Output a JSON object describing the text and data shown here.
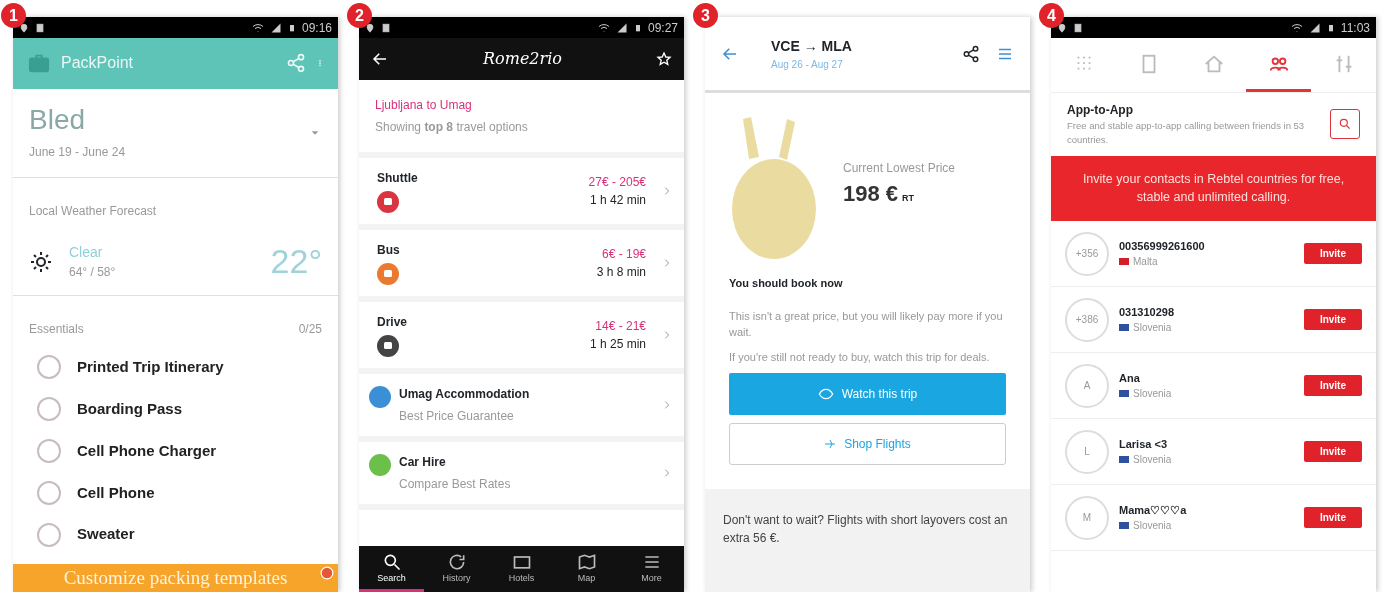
{
  "screens": [
    {
      "kind": "packing",
      "badge": "1",
      "status_time": "09:16",
      "app_title": "PackPoint",
      "trip": {
        "name": "Bled",
        "dates": "June 19 - June 24"
      },
      "weather": {
        "heading": "Local Weather Forecast",
        "condition": "Clear",
        "range": "64° / 58°",
        "temperature": "22°"
      },
      "list": {
        "heading": "Essentials",
        "count": "0/25",
        "items": [
          {
            "label": "Printed Trip Itinerary",
            "checked": false
          },
          {
            "label": "Boarding Pass",
            "checked": false
          },
          {
            "label": "Cell Phone Charger",
            "checked": false
          },
          {
            "label": "Cell Phone",
            "checked": false
          },
          {
            "label": "Sweater",
            "checked": false
          }
        ]
      },
      "footer": "Customize packing templates"
    },
    {
      "kind": "routes",
      "badge": "2",
      "status_time": "09:27",
      "logo": "Rome2rio",
      "route": "Ljubljana to Umag",
      "summary": "Showing **top 8** travel options",
      "options": [
        {
          "mode": "Shuttle",
          "price": "27€ - 205€",
          "duration": "1 h 42 min",
          "color": "#d9343f"
        },
        {
          "mode": "Bus",
          "price": "6€ - 19€",
          "duration": "3 h 8 min",
          "color": "#ec7a2e"
        },
        {
          "mode": "Drive",
          "price": "14€ - 21€",
          "duration": "1 h 25 min",
          "color": "#444444"
        }
      ],
      "links": [
        {
          "title": "Umag Accommodation",
          "subtitle": "Best Price Guarantee",
          "color": "#3a8fd6"
        },
        {
          "title": "Car Hire",
          "subtitle": "Compare Best Rates",
          "color": "#6cc04a"
        }
      ],
      "nav": [
        {
          "label": "Search",
          "selected": true
        },
        {
          "label": "History",
          "selected": false
        },
        {
          "label": "Hotels",
          "selected": false
        },
        {
          "label": "Map",
          "selected": false
        },
        {
          "label": "More",
          "selected": false
        }
      ]
    },
    {
      "kind": "price",
      "badge": "3",
      "route": "VCE → MLA",
      "dates": "Aug 26 - Aug 27",
      "price_label": "Current Lowest Price",
      "price": "198 €",
      "price_note": "RT",
      "advice": "You should book now",
      "paragraphs": [
        "This isn't a great price, but you will likely pay more if you wait.",
        "If you're still not ready to buy, watch this trip for deals."
      ],
      "buttons": [
        {
          "label": "Watch this trip",
          "kind": "primary"
        },
        {
          "label": "Shop Flights",
          "kind": "outline"
        }
      ],
      "tip": "Don't want to wait? Flights with short layovers cost an extra 56 €."
    },
    {
      "kind": "calling",
      "badge": "4",
      "status_time": "11:03",
      "tabs": [
        {
          "selected": false
        },
        {
          "selected": false
        },
        {
          "selected": false
        },
        {
          "selected": true
        },
        {
          "selected": false
        }
      ],
      "title": "App-to-App",
      "description": "Free and stable app-to-app calling between friends in 53 countries.",
      "banner": "Invite your contacts in Rebtel countries for free, stable and unlimited calling.",
      "contacts": [
        {
          "avatar": "+356",
          "name": "00356999261600",
          "country": "Malta",
          "color": "#d21f2b",
          "action": "Invite"
        },
        {
          "avatar": "+386",
          "name": "031310298",
          "country": "Slovenia",
          "color": "#3050a0",
          "action": "Invite"
        },
        {
          "avatar": "A",
          "name": "Ana",
          "country": "Slovenia",
          "color": "#3050a0",
          "action": "Invite"
        },
        {
          "avatar": "L",
          "name": "Larisa <3",
          "country": "Slovenia",
          "color": "#3050a0",
          "action": "Invite"
        },
        {
          "avatar": "M",
          "name": "Mama♡♡♡a",
          "country": "Slovenia",
          "color": "#3050a0",
          "action": "Invite"
        }
      ]
    }
  ]
}
